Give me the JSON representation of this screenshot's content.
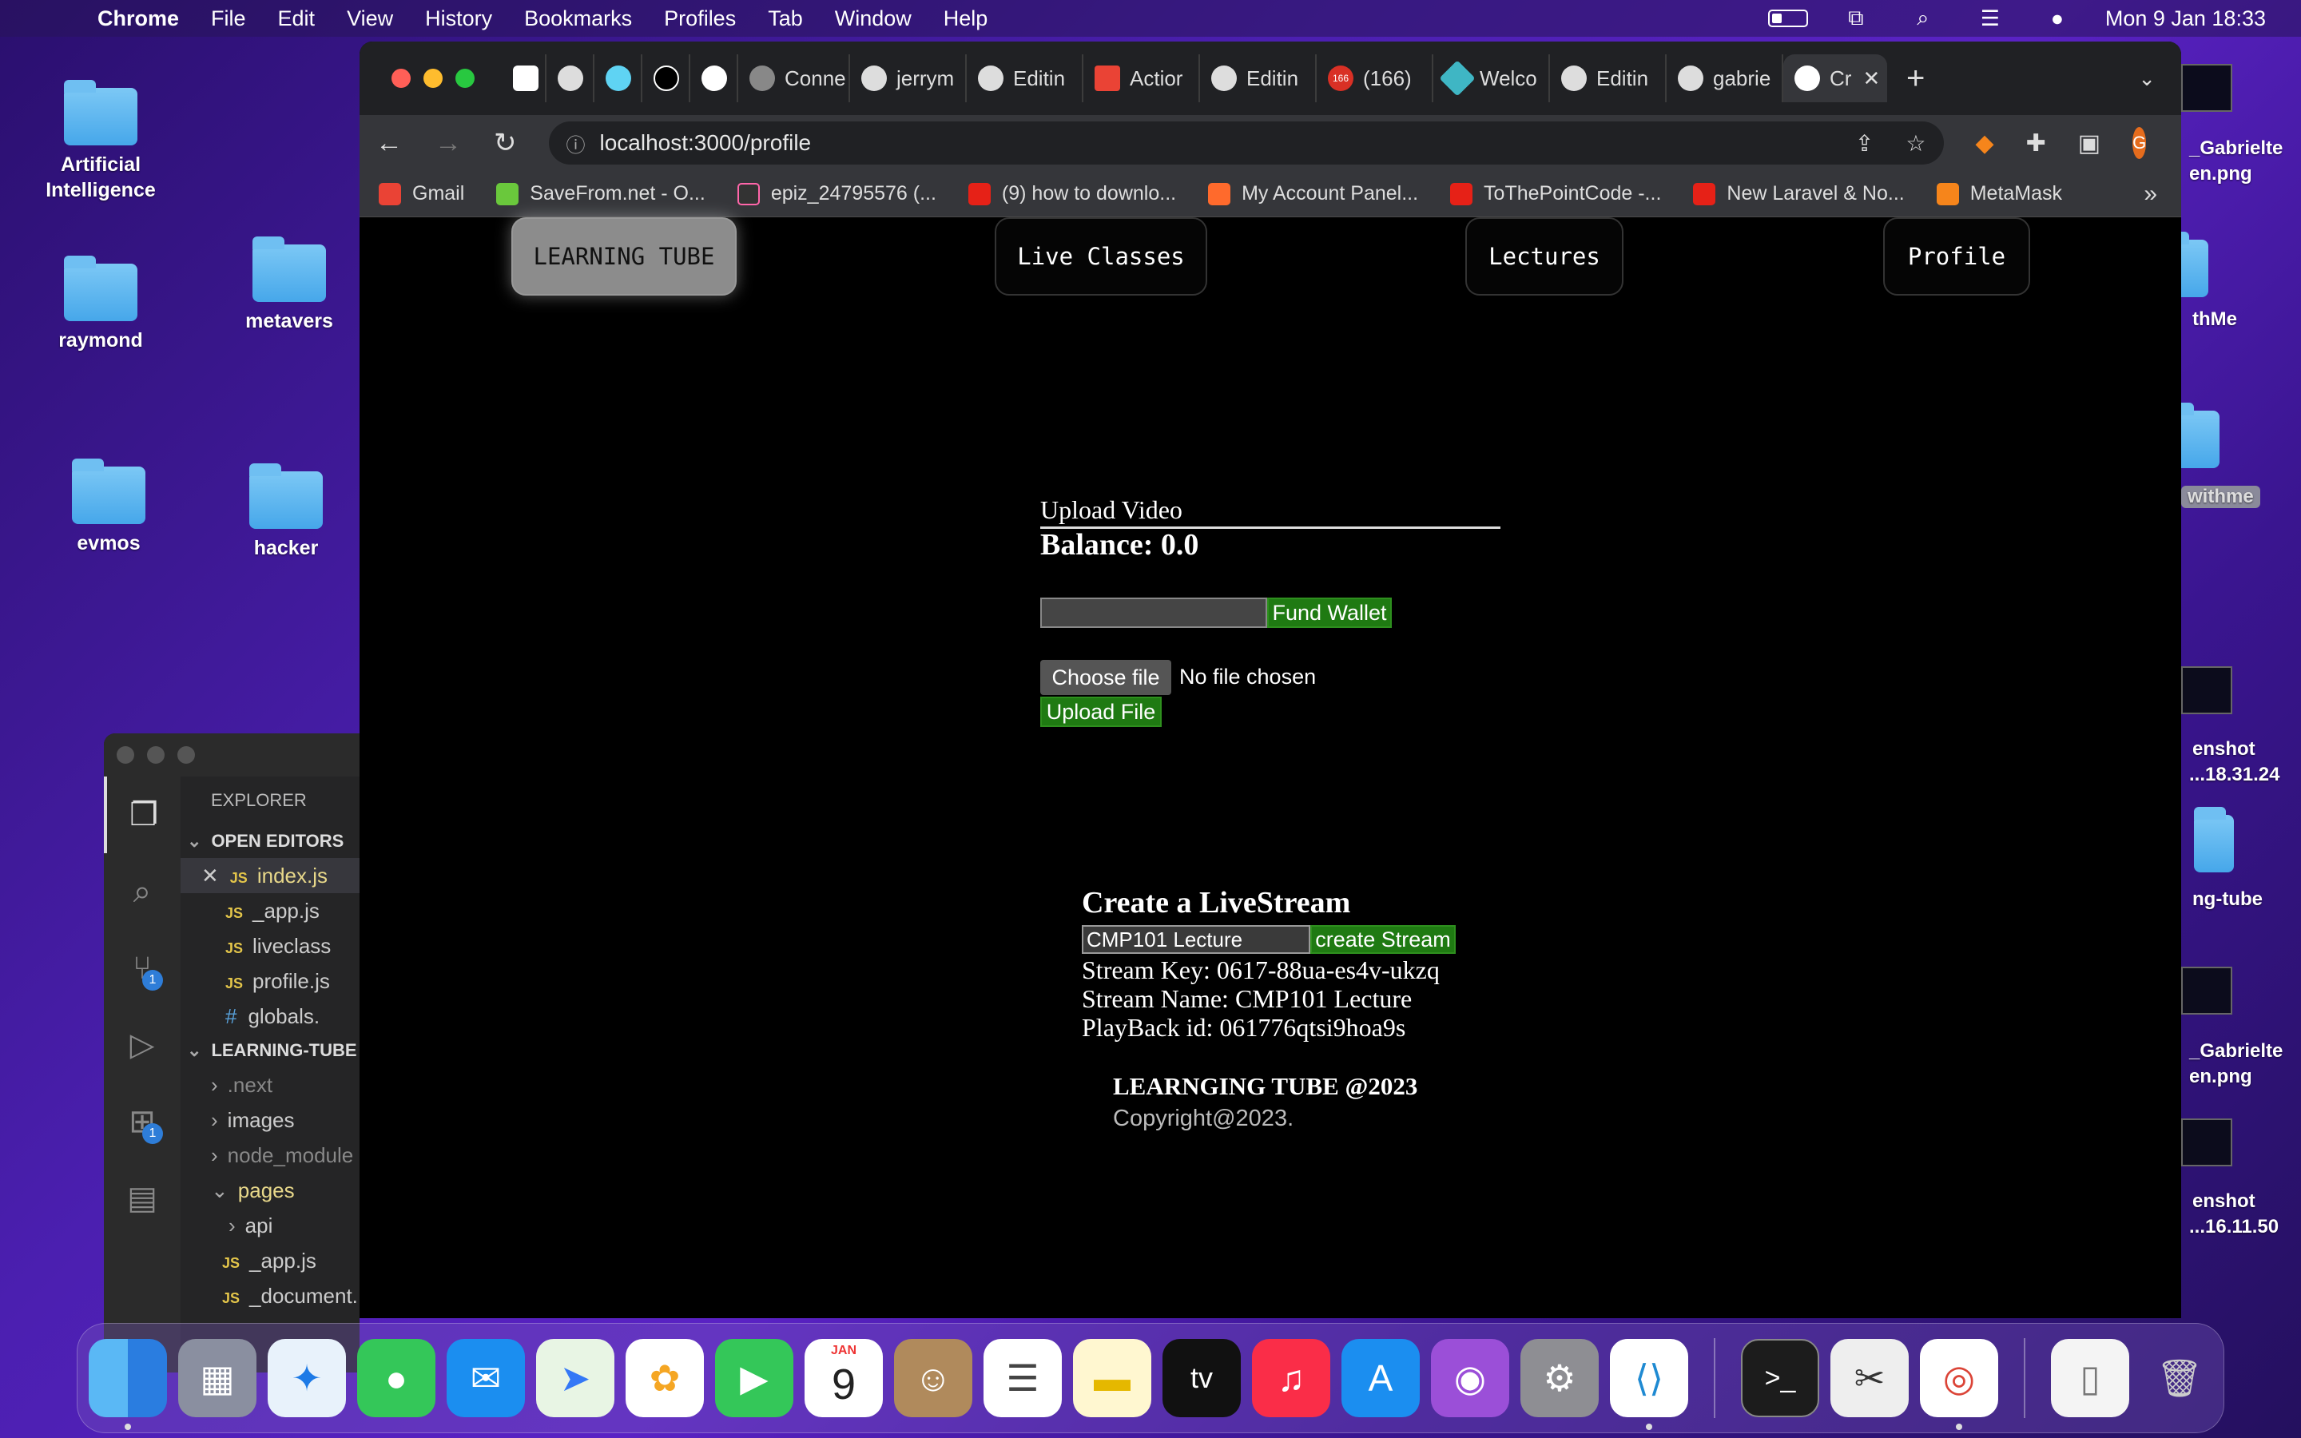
{
  "menubar": {
    "app_name": "Chrome",
    "items": [
      "File",
      "Edit",
      "View",
      "History",
      "Bookmarks",
      "Profiles",
      "Tab",
      "Window",
      "Help"
    ],
    "clock": "Mon 9 Jan  18:33"
  },
  "desktop": {
    "icons": [
      "Artificial Intelligence",
      "raymond",
      "metavers",
      "evmos",
      "hacker"
    ],
    "right_labels": [
      "_Gabrielte",
      "en.png",
      "thMe",
      "withme",
      "enshot",
      "...18.31.24",
      "ng-tube",
      "_Gabrielte",
      "en.png",
      "enshot",
      "...16.11.50"
    ]
  },
  "vscode": {
    "explorer_title": "EXPLORER",
    "open_editors_title": "OPEN EDITORS",
    "open_editors": [
      "index.js",
      "_app.js",
      "liveclass",
      "profile.js",
      "globals."
    ],
    "project_title": "LEARNING-TUBE",
    "tree": [
      ".next",
      "images",
      "node_module",
      "pages",
      "api",
      "_app.js",
      "_document."
    ],
    "badges": [
      "1",
      "1"
    ]
  },
  "chrome": {
    "tabs": [
      "Conne",
      "jerrym",
      "Editin",
      "Actior",
      "Editin",
      "(166)",
      "Welco",
      "Editin",
      "gabrie",
      "Cr"
    ],
    "tab_badge": "166",
    "url": "localhost:3000/profile",
    "avatar_letter": "G",
    "bookmarks": [
      "Gmail",
      "SaveFrom.net - O...",
      "epiz_24795576 (...",
      "(9) how to downlo...",
      "My Account Panel...",
      "ToThePointCode -...",
      "New Laravel & No...",
      "MetaMask"
    ],
    "bookmarks_more": "»"
  },
  "page": {
    "nav": {
      "brand": "LEARNING TUBE",
      "live_classes": "Live Classes",
      "lectures": "Lectures",
      "profile": "Profile"
    },
    "upload_title": "Upload Video",
    "balance": "Balance: 0.0",
    "fund_input_value": "",
    "fund_button": "Fund Wallet",
    "choose_file": "Choose file",
    "no_file": "No file chosen",
    "upload_button": "Upload File",
    "livestream_title": "Create a LiveStream",
    "stream_input_value": "CMP101 Lecture",
    "create_stream_button": "create Stream",
    "stream_key": "Stream Key: 0617-88ua-es4v-ukzq",
    "stream_name": "Stream Name: CMP101 Lecture",
    "playback_id": "PlayBack id: 061776qtsi9hoa9s",
    "footer_title": "LEARNGING TUBE @2023",
    "copyright": "Copyright@2023."
  },
  "dock": {
    "calendar_month": "JAN",
    "calendar_day": "9",
    "tv_label": "tv"
  }
}
